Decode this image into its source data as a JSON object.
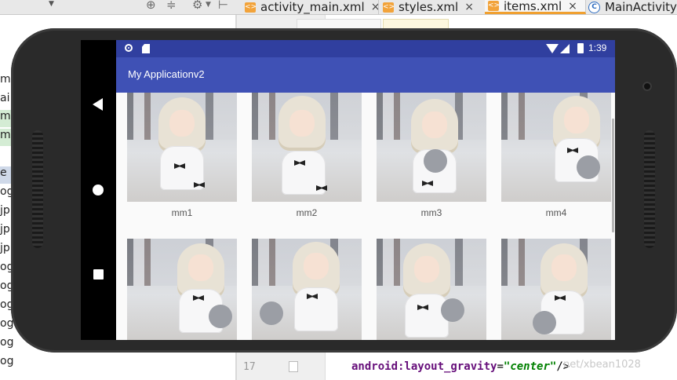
{
  "ide": {
    "tabs": [
      {
        "label": "activity_main.xml",
        "icon": "xml-file-icon",
        "active": false
      },
      {
        "label": "styles.xml",
        "icon": "xml-file-icon",
        "active": false
      },
      {
        "label": "items.xml",
        "icon": "xml-file-icon",
        "active": true
      },
      {
        "label": "MainActivity",
        "icon": "java-class-icon",
        "active": false
      }
    ],
    "tab_icon_letter_xml": "<>",
    "tab_icon_letter_class": "C",
    "close_glyph": "×",
    "project_rows": [
      "m",
      "ai",
      "m",
      "m",
      "e",
      "og",
      "jp",
      "jp",
      "jp",
      "og",
      "og",
      "og",
      "og",
      "og",
      "og"
    ],
    "editor": {
      "line_number": "17",
      "code_attr": "android:layout_gravity",
      "code_eq": "=",
      "code_value": "\"center\"",
      "code_tail": "/>",
      "watermark": "net/xbean1028"
    }
  },
  "emulator": {
    "status_bar": {
      "time": "1:39",
      "color": "#303f9f"
    },
    "app_bar": {
      "title": "My Applicationv2",
      "color": "#3f51b5"
    },
    "items": [
      {
        "caption": "mm1",
        "image": "girl-photo"
      },
      {
        "caption": "mm2",
        "image": "girl-photo"
      },
      {
        "caption": "mm3",
        "image": "girl-photo"
      },
      {
        "caption": "mm4",
        "image": "girl-photo"
      },
      {
        "caption": "",
        "image": "girl-photo"
      },
      {
        "caption": "",
        "image": "girl-photo"
      },
      {
        "caption": "",
        "image": "girl-photo"
      },
      {
        "caption": "",
        "image": "girl-photo"
      }
    ]
  }
}
